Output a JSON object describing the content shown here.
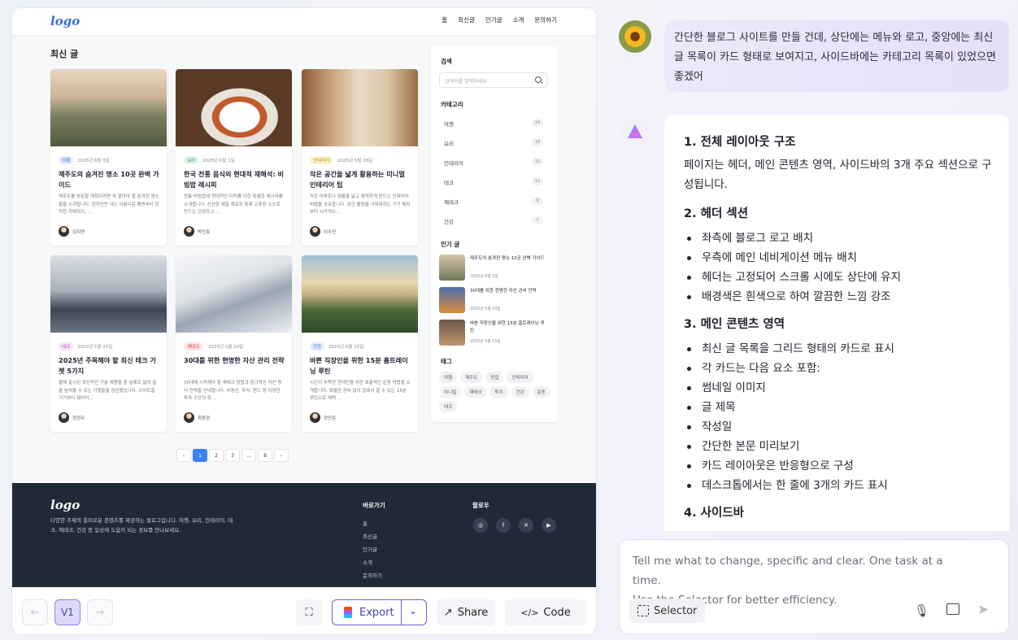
{
  "site": {
    "logo": "logo",
    "nav": [
      "홈",
      "최신글",
      "인기글",
      "소개",
      "문의하기"
    ],
    "section_title": "최신 글",
    "posts": [
      {
        "category": "여행",
        "date": "2025년 6월 3일",
        "title": "제주도의 숨겨진 명소 10곳 완벽 가이드",
        "excerpt": "제주도를 방문할 계획이라면 꼭 알아야 할 숨겨진 명소들을 소개합니다. 현지인만 아는 아름다운 해변부터 한적한 카페까지, …",
        "author": "김지연"
      },
      {
        "category": "요리",
        "date": "2025년 6월 1일",
        "title": "한국 전통 음식의 현대적 재해석: 비빔밥 레시피",
        "excerpt": "전통 비빔밥에 현대적인 터치를 더한 특별한 레시피를 소개합니다. 신선한 제철 재료와 특제 고추장 소스로 만드는 건강하고 …",
        "author": "박민호"
      },
      {
        "category": "인테리어",
        "date": "2025년 5월 28일",
        "title": "작은 공간을 넓게 활용하는 미니멀 인테리어 팁",
        "excerpt": "작은 아파트나 원룸을 넓고 쾌적하게 만드는 인테리어 비법을 공유합니다. 공간 활용을 극대화하는 가구 배치부터 시각적으…",
        "author": "이수진"
      },
      {
        "category": "테크",
        "date": "2025년 5월 25일",
        "title": "2025년 주목해야 할 최신 테크 가젯 5가지",
        "excerpt": "올해 출시된 혁신적인 기술 제품들 중 실제로 삶의 질을 높여줄 수 있는 가젯들을 엄선했습니다. 스마트홈 기기부터 웨어러…",
        "author": "정현우"
      },
      {
        "category": "재테크",
        "date": "2025년 5월 20일",
        "title": "30대를 위한 현명한 자산 관리 전략",
        "excerpt": "30대에 시작해야 할 재테크 방법과 장기적인 자산 증식 전략을 안내합니다. 부동산, 주식, 펀드 등 다양한 투자 수단의 장…",
        "author": "최동현"
      },
      {
        "category": "건강",
        "date": "2025년 5월 15일",
        "title": "바쁜 직장인을 위한 15분 홈트레이닝 루틴",
        "excerpt": "시간이 부족한 현대인을 위한 효율적인 운동 방법을 소개합니다. 특별한 장비 없이 집에서 할 수 있는 15분 루틴으로 체력 …",
        "author": "강민준"
      }
    ],
    "pagination": [
      "‹",
      "1",
      "2",
      "3",
      "...",
      "8",
      "›"
    ],
    "sidebar": {
      "search_title": "검색",
      "search_placeholder": "검색어를 입력하세요",
      "category_title": "카테고리",
      "categories": [
        {
          "name": "여행",
          "count": "24"
        },
        {
          "name": "요리",
          "count": "18"
        },
        {
          "name": "인테리어",
          "count": "15"
        },
        {
          "name": "테크",
          "count": "12"
        },
        {
          "name": "재테크",
          "count": "9"
        },
        {
          "name": "건강",
          "count": "7"
        }
      ],
      "popular_title": "인기 글",
      "popular": [
        {
          "title": "제주도의 숨겨진 명소 10곳 완벽 가이드",
          "date": "2025년 6월 3일"
        },
        {
          "title": "30대를 위한 현명한 자산 관리 전략",
          "date": "2025년 5월 20일"
        },
        {
          "title": "바쁜 직장인을 위한 15분 홈트레이닝 루틴",
          "date": "2025년 5월 15일"
        }
      ],
      "tags_title": "태그",
      "tags": [
        "여행",
        "제주도",
        "맛집",
        "인테리어",
        "미니멀",
        "재테크",
        "투자",
        "건강",
        "운동",
        "테크"
      ]
    },
    "footer": {
      "logo": "logo",
      "description": "다양한 주제의 흥미로운 콘텐츠를 제공하는 블로그입니다. 여행, 요리, 인테리어, 테크, 재테크, 건강 등 일상에 도움이 되는 정보를 만나보세요.",
      "links_title": "바로가기",
      "links": [
        "홈",
        "최신글",
        "인기글",
        "소개",
        "문의하기"
      ],
      "follow_title": "팔로우"
    }
  },
  "toolbar": {
    "version": "V1",
    "export_label": "Export",
    "share_label": "Share",
    "code_label": "Code"
  },
  "chat": {
    "user_message": "간단한 블로그 사이트를 만들 건데, 상단에는 메뉴와 로고, 중앙에는 최신 글 목록이 카드 형태로 보여지고, 사이드바에는 카테고리 목록이 있었으면 좋겠어",
    "h1": "1. 전체 레이아웃 구조",
    "p1": "페이지는 헤더, 메인 콘텐츠 영역, 사이드바의 3개 주요 섹션으로 구성됩니다.",
    "h2": "2. 헤더 섹션",
    "header_items": [
      "좌측에 블로그 로고 배치",
      "우측에 메인 네비게이션 메뉴 배치",
      "헤더는 고정되어 스크롤 시에도 상단에 유지",
      "배경색은 흰색으로 하여 깔끔한 느낌 강조"
    ],
    "h3": "3. 메인 콘텐츠 영역",
    "main_items": [
      "최신 글 목록을 그리드 형태의 카드로 표시",
      "각 카드는 다음 요소 포함:",
      "썸네일 이미지",
      "글 제목",
      "작성일",
      "간단한 본문 미리보기",
      "카드 레이아웃은 반응형으로 구성",
      "데스크톱에서는 한 줄에 3개의 카드 표시"
    ],
    "h4": "4. 사이드바",
    "input_placeholder_1": "Tell me what to change, specific and clear. One task at a time.",
    "input_placeholder_2": "Use the Selector for better efficiency.",
    "selector_label": "Selector"
  },
  "colors": {
    "accent": "#3b82f6",
    "brand_purple": "#5b4fd6",
    "footer_bg": "#1f2937"
  }
}
